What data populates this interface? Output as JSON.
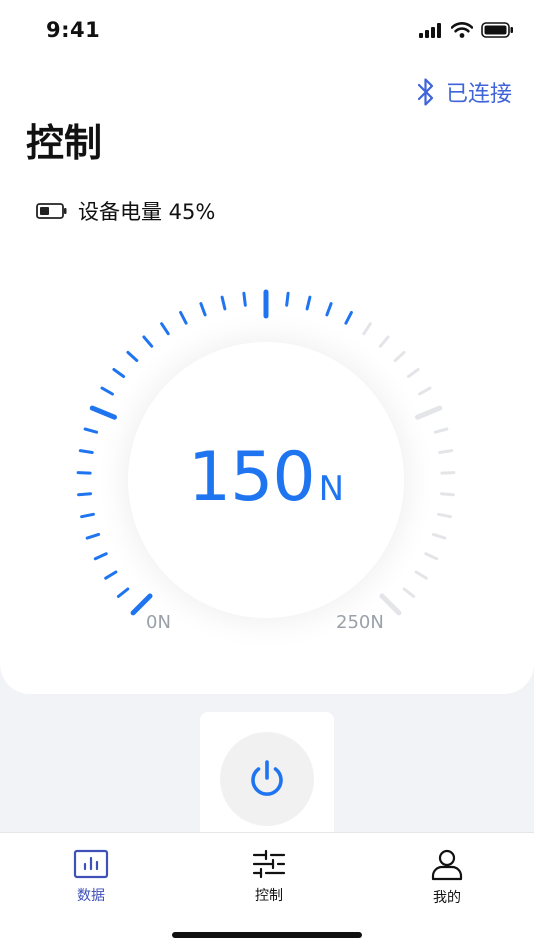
{
  "status_bar": {
    "time": "9:41"
  },
  "header": {
    "connection_label": "已连接",
    "title": "控制"
  },
  "battery": {
    "label": "设备电量 45%",
    "level": 0.45
  },
  "gauge": {
    "value": "150",
    "unit": "N",
    "min_label": "0N",
    "max_label": "250N",
    "fraction": 0.6,
    "active_color": "#1f74f0",
    "inactive_color": "#e3e5e8"
  },
  "tabs": [
    {
      "label": "数据",
      "icon": "bar-chart-icon",
      "active": true
    },
    {
      "label": "控制",
      "icon": "sliders-icon",
      "active": false
    },
    {
      "label": "我的",
      "icon": "user-icon",
      "active": false
    }
  ],
  "colors": {
    "accent": "#1f74f0",
    "tab_active": "#3f50b8",
    "bluetooth": "#3f63d9"
  }
}
